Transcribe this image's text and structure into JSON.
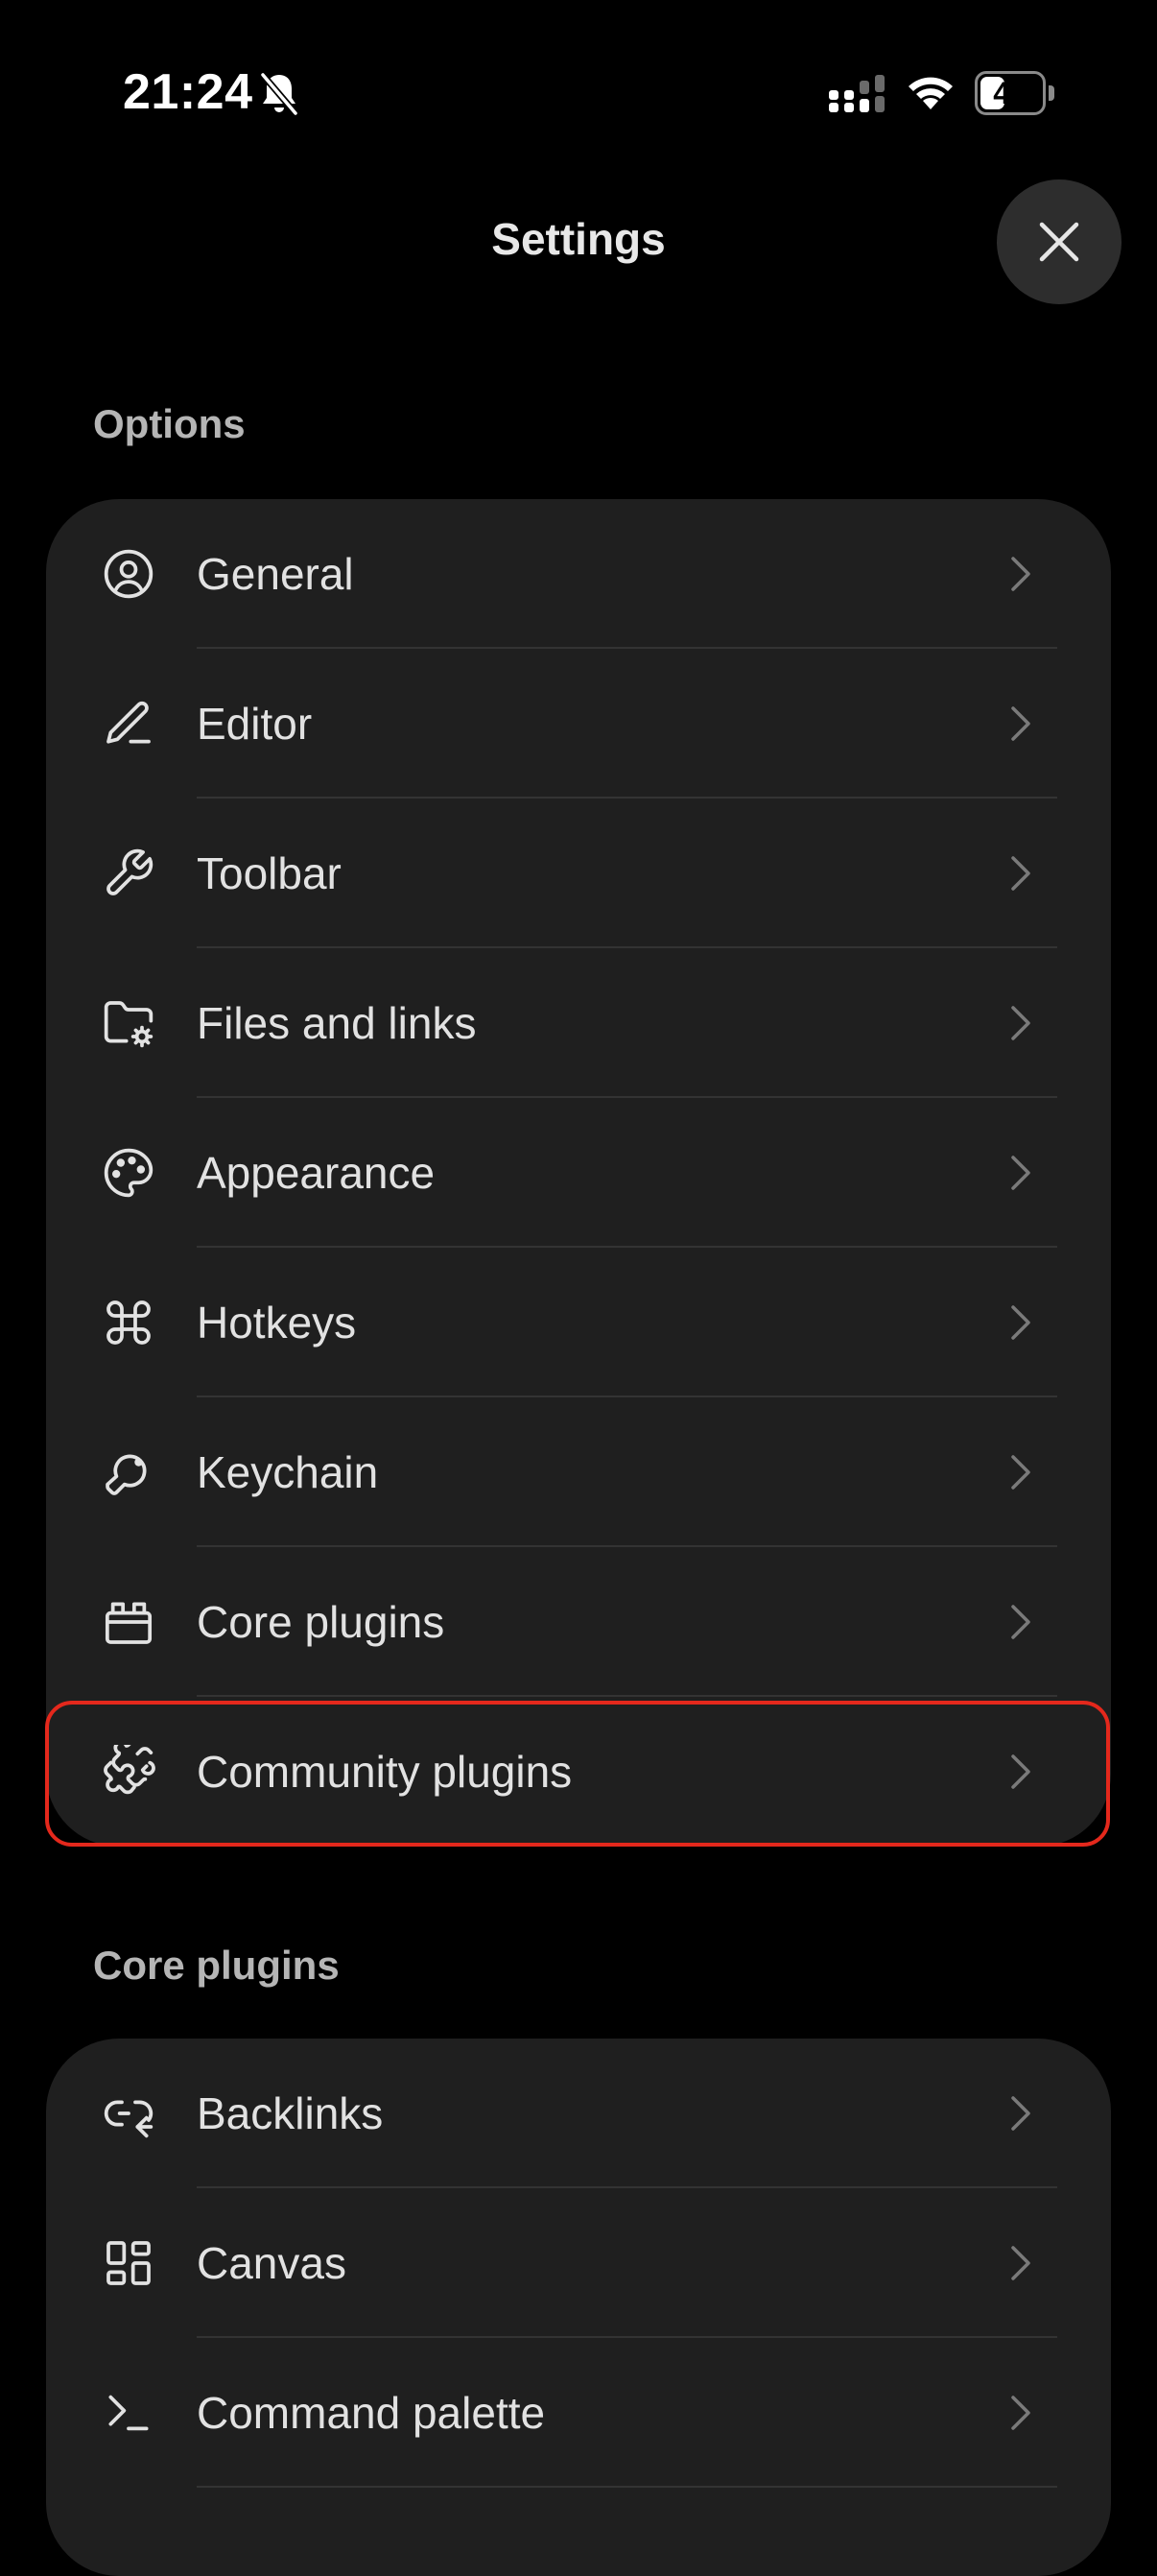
{
  "status_bar": {
    "time": "21:24",
    "battery_level": "40",
    "battery_fraction": 0.4
  },
  "header": {
    "title": "Settings"
  },
  "options": {
    "section_title": "Options",
    "items": [
      {
        "label": "General",
        "icon": "user-circle-icon"
      },
      {
        "label": "Editor",
        "icon": "pencil-icon"
      },
      {
        "label": "Toolbar",
        "icon": "wrench-icon"
      },
      {
        "label": "Files and links",
        "icon": "folder-cog-icon"
      },
      {
        "label": "Appearance",
        "icon": "palette-icon"
      },
      {
        "label": "Hotkeys",
        "icon": "command-icon"
      },
      {
        "label": "Keychain",
        "icon": "key-icon"
      },
      {
        "label": "Core plugins",
        "icon": "briefcase-icon"
      },
      {
        "label": "Community plugins",
        "icon": "puzzle-icon"
      }
    ]
  },
  "core_plugins": {
    "section_title": "Core plugins",
    "items": [
      {
        "label": "Backlinks",
        "icon": "link-back-icon"
      },
      {
        "label": "Canvas",
        "icon": "layout-dashboard-icon"
      },
      {
        "label": "Command palette",
        "icon": "terminal-icon"
      }
    ]
  },
  "colors": {
    "background": "#000000",
    "card": "#1f1f1f",
    "highlight": "#e4281c"
  }
}
